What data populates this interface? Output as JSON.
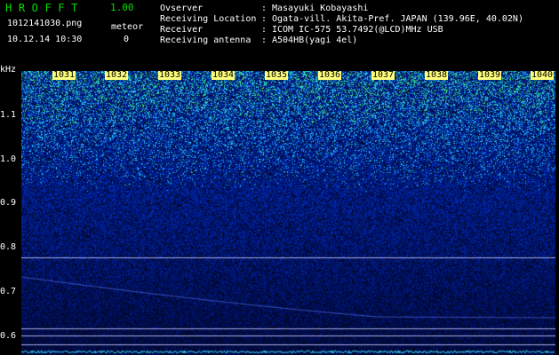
{
  "app": {
    "title": "HROFFT",
    "version": "1.00"
  },
  "file": {
    "name": "1012141030.png",
    "datetime": "10.12.14 10:30"
  },
  "meteor": {
    "label": "meteor",
    "count": "0"
  },
  "info": [
    {
      "label": "Ovserver",
      "value": "Masayuki Kobayashi"
    },
    {
      "label": "Receiving Location",
      "value": "Ogata-vill. Akita-Pref. JAPAN (139.96E, 40.02N)"
    },
    {
      "label": "Receiver",
      "value": "ICOM IC-575 53.7492(@LCD)MHz USB"
    },
    {
      "label": "Receiving antenna",
      "value": "A504HB(yagi 4el)"
    }
  ],
  "axis": {
    "y_unit": "kHz",
    "y_ticks": [
      "1.1",
      "1.0",
      "0.9",
      "0.8",
      "0.7",
      "0.6"
    ],
    "x_ticks": [
      "1031",
      "1032",
      "1033",
      "1034",
      "1035",
      "1036",
      "1037",
      "1038",
      "1039",
      "1040"
    ]
  },
  "colors": {
    "background": "#000000",
    "title": "#00e000",
    "noise_low": "#0010a0",
    "noise_high": "#40ff40",
    "tick_label_bg": "#ffff7a",
    "reference_line": "#c8c8ff",
    "baseline_trace": "#40e0ff"
  }
}
